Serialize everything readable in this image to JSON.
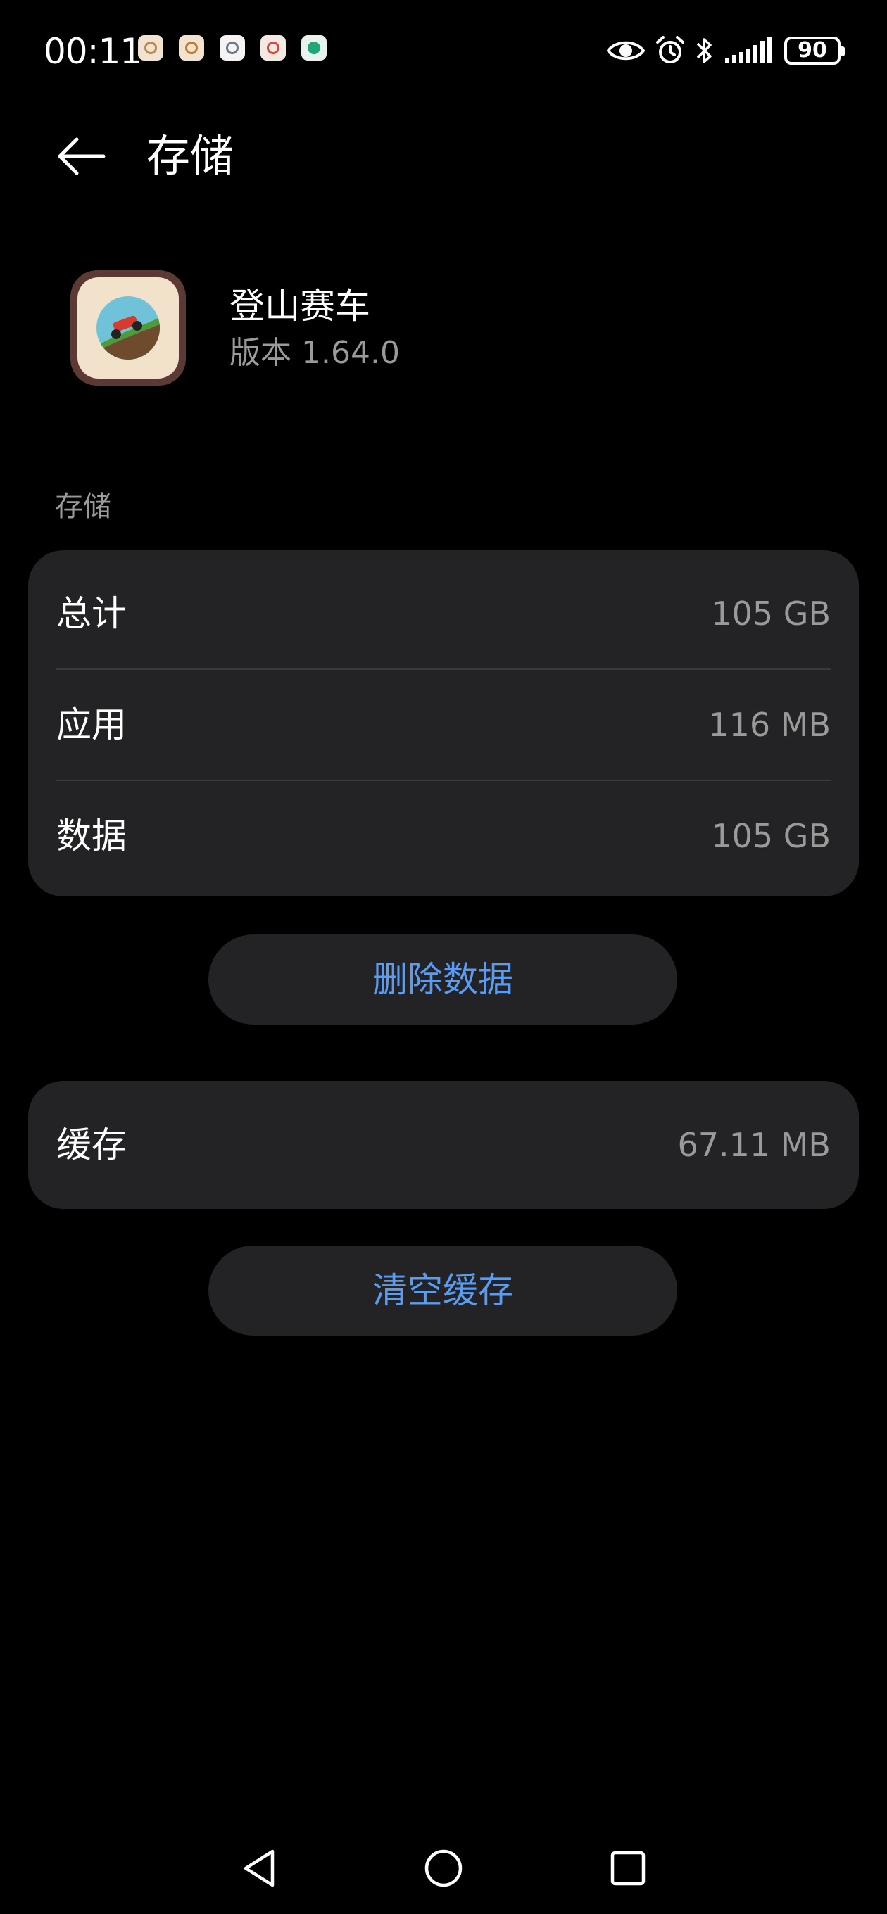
{
  "status_bar": {
    "time": "00:11",
    "battery_level": "90",
    "notification_icons": [
      "app-notification-icon",
      "app-notification-icon",
      "app-notification-icon",
      "app-notification-icon",
      "app-notification-icon"
    ],
    "system_icons": [
      "eye-icon",
      "alarm-icon",
      "bluetooth-icon",
      "signal-icon",
      "battery-icon"
    ]
  },
  "header": {
    "title": "存储",
    "back_icon": "arrow-left-icon"
  },
  "app": {
    "name": "登山赛车",
    "version": "版本 1.64.0"
  },
  "storage": {
    "section_label": "存储",
    "rows": [
      {
        "label": "总计",
        "value": "105 GB"
      },
      {
        "label": "应用",
        "value": "116 MB"
      },
      {
        "label": "数据",
        "value": "105 GB"
      }
    ],
    "delete_button_label": "删除数据"
  },
  "cache": {
    "label": "缓存",
    "value": "67.11 MB",
    "clear_button_label": "清空缓存"
  },
  "nav_bar": {
    "icons": [
      "triangle-back-icon",
      "circle-home-icon",
      "square-recents-icon"
    ]
  },
  "colors": {
    "background": "#000000",
    "card": "#232325",
    "accent": "#5b9cf0",
    "secondary_text": "#9a9a9a",
    "divider": "#3a3a3c"
  }
}
